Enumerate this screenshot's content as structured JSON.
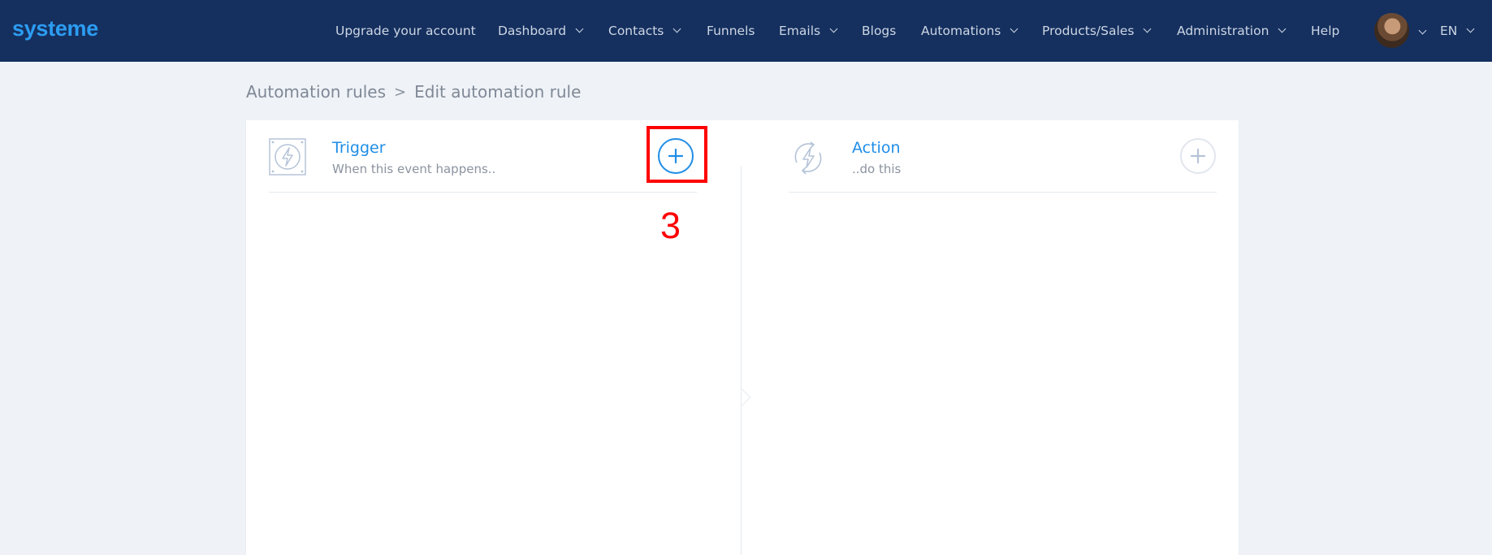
{
  "header": {
    "logo": "systeme",
    "nav": [
      {
        "label": "Upgrade your account",
        "dropdown": false
      },
      {
        "label": "Dashboard",
        "dropdown": true
      },
      {
        "label": "Contacts",
        "dropdown": true
      },
      {
        "label": "Funnels",
        "dropdown": false
      },
      {
        "label": "Emails",
        "dropdown": true
      },
      {
        "label": "Blogs",
        "dropdown": false
      },
      {
        "label": "Automations",
        "dropdown": true
      },
      {
        "label": "Products/Sales",
        "dropdown": true
      },
      {
        "label": "Administration",
        "dropdown": true
      },
      {
        "label": "Help",
        "dropdown": false
      }
    ],
    "language": "EN"
  },
  "breadcrumb": {
    "parent": "Automation rules",
    "separator": ">",
    "current": "Edit automation rule"
  },
  "trigger": {
    "title": "Trigger",
    "subtitle": "When this event happens..",
    "icon": "lightning-bolt-icon"
  },
  "action": {
    "title": "Action",
    "subtitle": "..do this",
    "icon": "lightning-refresh-icon"
  },
  "annotation": {
    "step": "3",
    "color": "#ff0000"
  },
  "colors": {
    "header_bg": "#15305f",
    "logo": "#2c9cf2",
    "accent": "#1f8de6",
    "page_bg": "#eff3f8"
  }
}
